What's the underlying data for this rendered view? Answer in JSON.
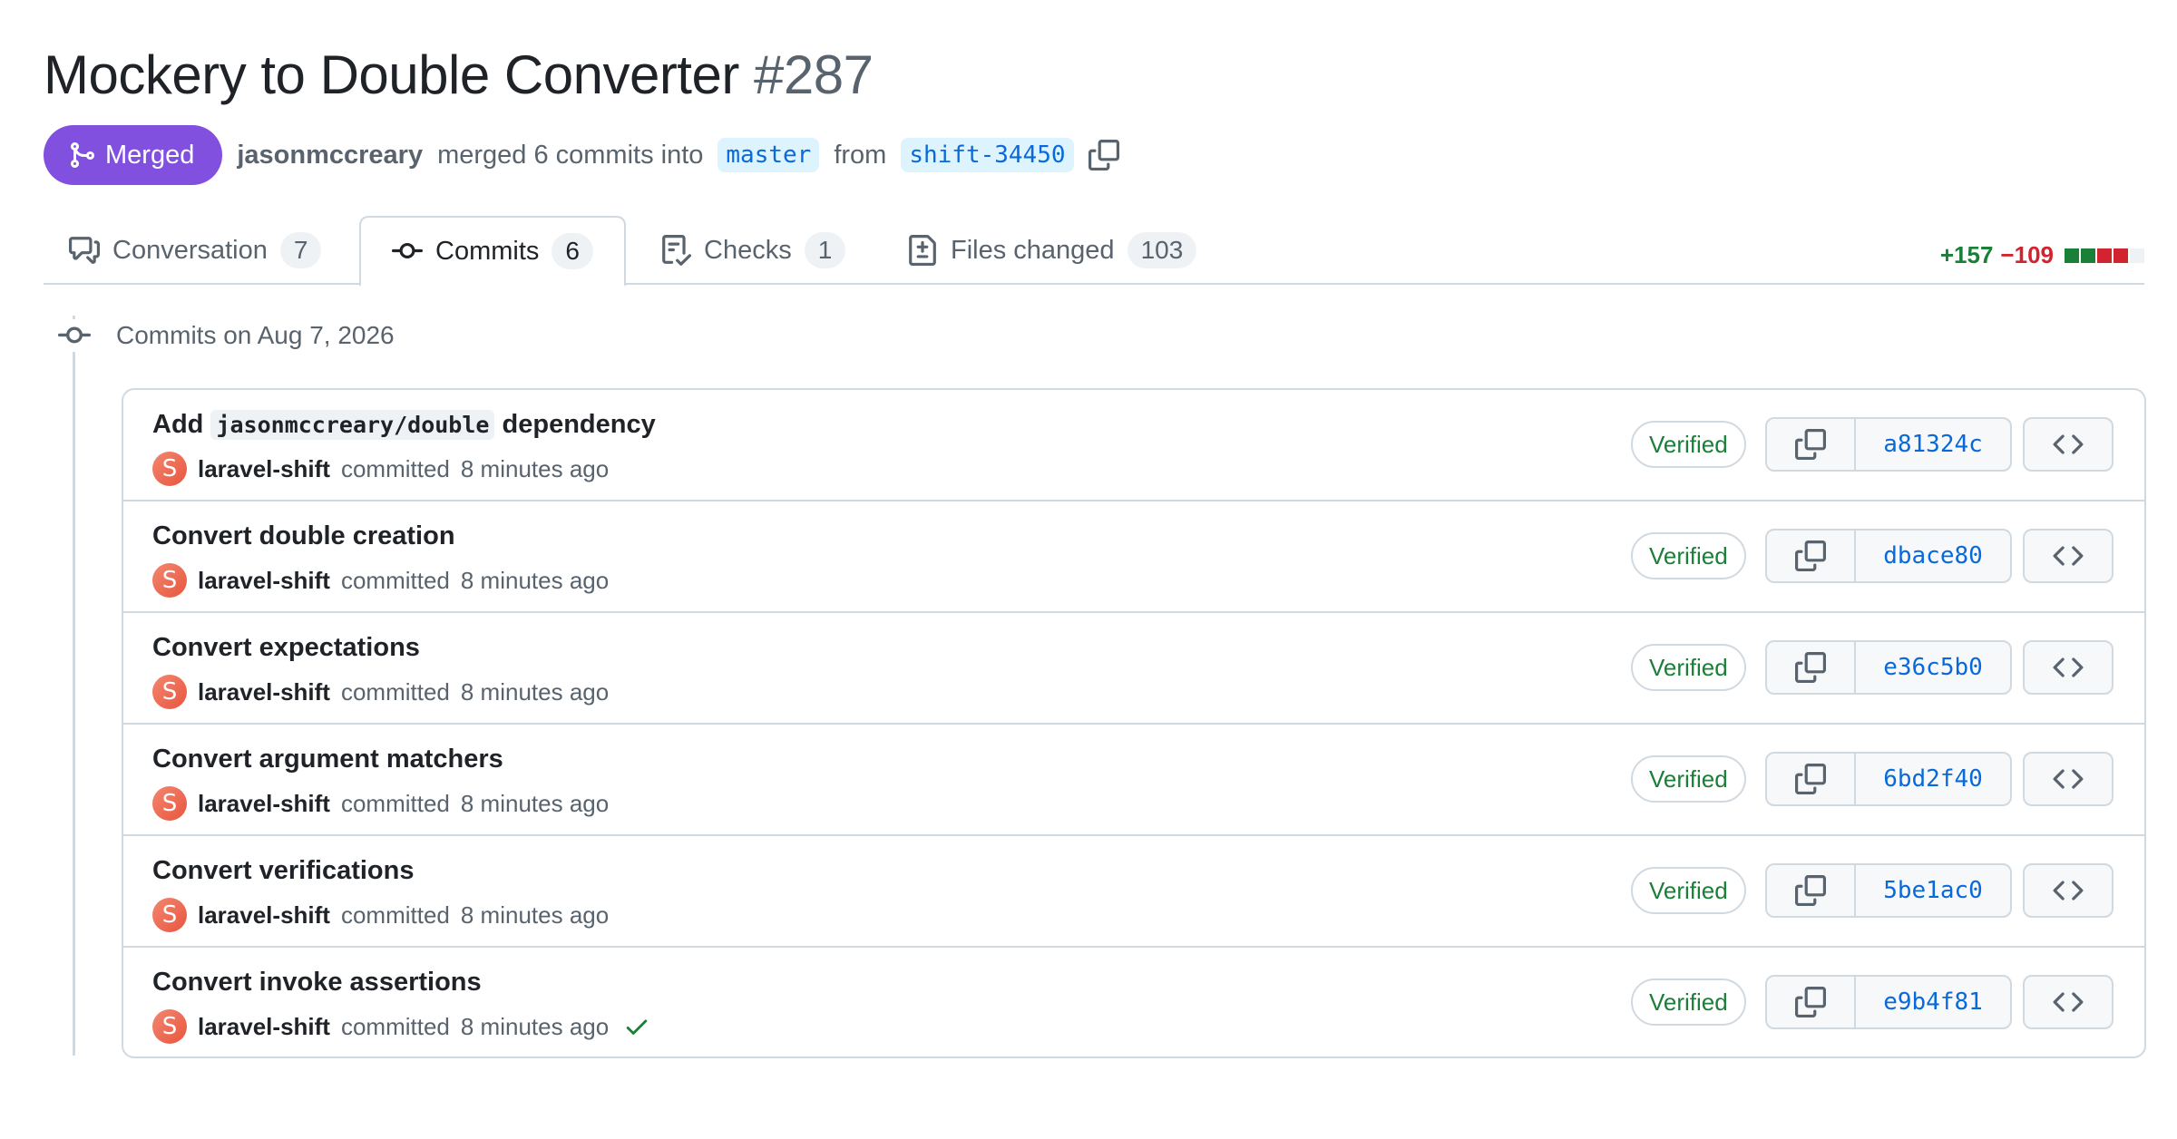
{
  "pr": {
    "title": "Mockery to Double Converter",
    "number": "#287",
    "state": "Merged",
    "author": "jasonmccreary",
    "merged_text": "merged 6 commits into",
    "base_branch": "master",
    "from_text": "from",
    "head_branch": "shift-34450"
  },
  "tabs": [
    {
      "label": "Conversation",
      "count": "7",
      "icon": "comment-discussion-icon"
    },
    {
      "label": "Commits",
      "count": "6",
      "icon": "git-commit-icon",
      "active": true
    },
    {
      "label": "Checks",
      "count": "1",
      "icon": "checklist-icon"
    },
    {
      "label": "Files changed",
      "count": "103",
      "icon": "file-diff-icon"
    }
  ],
  "diffstat": {
    "additions": "+157",
    "deletions": "−109",
    "blocks": [
      "#1a7f37",
      "#1a7f37",
      "#d1242f",
      "#d1242f",
      "#eff2f5"
    ]
  },
  "timeline": {
    "heading": "Commits on Aug 7, 2026"
  },
  "commits": [
    {
      "msg_before": "Add",
      "msg_code": "jasonmccreary/double",
      "msg_after": "dependency",
      "avatar": "S",
      "author": "laravel-shift",
      "action": "committed",
      "time": "8 minutes ago",
      "verified": "Verified",
      "sha": "a81324c"
    },
    {
      "msg": "Convert double creation",
      "avatar": "S",
      "author": "laravel-shift",
      "action": "committed",
      "time": "8 minutes ago",
      "verified": "Verified",
      "sha": "dbace80"
    },
    {
      "msg": "Convert expectations",
      "avatar": "S",
      "author": "laravel-shift",
      "action": "committed",
      "time": "8 minutes ago",
      "verified": "Verified",
      "sha": "e36c5b0"
    },
    {
      "msg": "Convert argument matchers",
      "avatar": "S",
      "author": "laravel-shift",
      "action": "committed",
      "time": "8 minutes ago",
      "verified": "Verified",
      "sha": "6bd2f40"
    },
    {
      "msg": "Convert verifications",
      "avatar": "S",
      "author": "laravel-shift",
      "action": "committed",
      "time": "8 minutes ago",
      "verified": "Verified",
      "sha": "5be1ac0"
    },
    {
      "msg": "Convert invoke assertions",
      "avatar": "S",
      "author": "laravel-shift",
      "action": "committed",
      "time": "8 minutes ago",
      "verified": "Verified",
      "sha": "e9b4f81",
      "status": "check-icon"
    }
  ],
  "colors": {
    "merged": "#8250df",
    "link": "#0969da",
    "success": "#1a7f37",
    "danger": "#d1242f"
  }
}
